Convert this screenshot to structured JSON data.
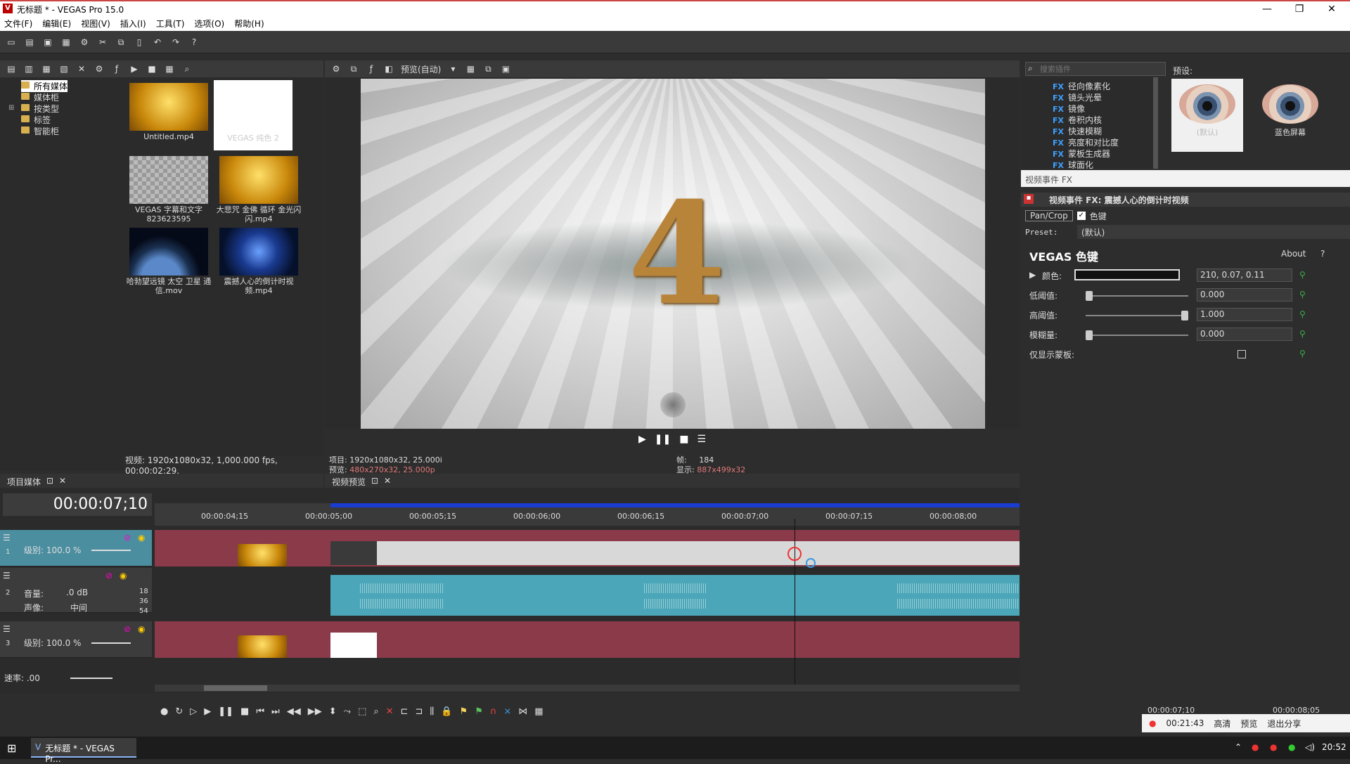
{
  "app": {
    "title": "无标题 * - VEGAS Pro 15.0",
    "icon": "V"
  },
  "window_controls": {
    "min": "—",
    "max": "❐",
    "close": "✕"
  },
  "menu": [
    "文件(F)",
    "编辑(E)",
    "视图(V)",
    "插入(I)",
    "工具(T)",
    "选项(O)",
    "帮助(H)"
  ],
  "media_tree": [
    "所有媒体",
    "媒体柜",
    "按类型",
    "标签",
    "智能柜"
  ],
  "media_items": [
    {
      "name": "Untitled.mp4"
    },
    {
      "name": "VEGAS 纯色 2"
    },
    {
      "name": "VEGAS 字幕和文字 823623595"
    },
    {
      "name": "大悲咒 金佛 循环 金光闪闪.mp4"
    },
    {
      "name": "哈勃望远镜 太空 卫星 通信.mov"
    },
    {
      "name": "震撼人心的倒计时视频.mp4"
    }
  ],
  "media_status": "视频: 1920x1080x32, 1,000.000 fps, 00:00:02;29,",
  "media_tab": {
    "label": "项目媒体",
    "float": "⊡",
    "close": "✕"
  },
  "preview": {
    "mode": "预览(自动)",
    "number": "4",
    "project": "项目: 1920x1080x32, 25.000i",
    "preview_res_label": "预览:",
    "preview_res": "480x270x32, 25.000p",
    "frame_label": "帧:",
    "frame": "184",
    "display_label": "显示:",
    "display": "887x499x32",
    "tab": "视频预览"
  },
  "fx_browser": {
    "search_placeholder": "搜索插件",
    "presets_label": "预设:",
    "items": [
      "径向像素化",
      "镜头光晕",
      "镜像",
      "卷积内核",
      "快速模糊",
      "亮度和对比度",
      "蒙板生成器",
      "球面化"
    ],
    "tag": "FX",
    "preset_cards": [
      "(默认)",
      "蓝色屏幕"
    ]
  },
  "fx_pane": {
    "title": "视频事件 FX",
    "event": "视频事件 FX: 震撼人心的倒计时视频",
    "chain": [
      "Pan/Crop",
      "色键"
    ],
    "preset_label": "Preset:",
    "preset_value": "(默认)",
    "plugin_name": "VEGAS 色键",
    "about": "About",
    "help": "?",
    "rows": [
      {
        "label": "颜色:",
        "value": "210, 0.07, 0.11"
      },
      {
        "label": "低阈值:",
        "value": "0.000",
        "level": 0.0
      },
      {
        "label": "高阈值:",
        "value": "1.000",
        "level": 1.0
      },
      {
        "label": "模糊量:",
        "value": "0.000",
        "level": 0.0
      },
      {
        "label": "仅显示蒙板:",
        "value": ""
      }
    ]
  },
  "timeline": {
    "timecode": "00:00:07;10",
    "ruler": [
      "00:00:04;15",
      "00:00:05;00",
      "00:00:05;15",
      "00:00:06;00",
      "00:00:06;15",
      "00:00:07;00",
      "00:00:07;15",
      "00:00:08;00"
    ],
    "track1": {
      "num": "1",
      "level_label": "级别: 100.0 %"
    },
    "track2": {
      "num": "2",
      "vol_label": "音量:",
      "vol": ".0 dB",
      "pan_label": "声像:",
      "pan": "中间",
      "meter": [
        "18",
        "36",
        "54"
      ]
    },
    "track3": {
      "num": "3",
      "level_label": "级别: 100.0 %"
    },
    "rate": "速率: .00"
  },
  "status_right": {
    "tc1": "00:00:07;10",
    "tc2": "00:00:08;05"
  },
  "recorder": {
    "time": "00:21:43",
    "hd": "高清",
    "preview": "预览",
    "exit": "退出分享"
  },
  "taskbar": {
    "app": "无标题 * - VEGAS Pr...",
    "time": "20:52"
  }
}
